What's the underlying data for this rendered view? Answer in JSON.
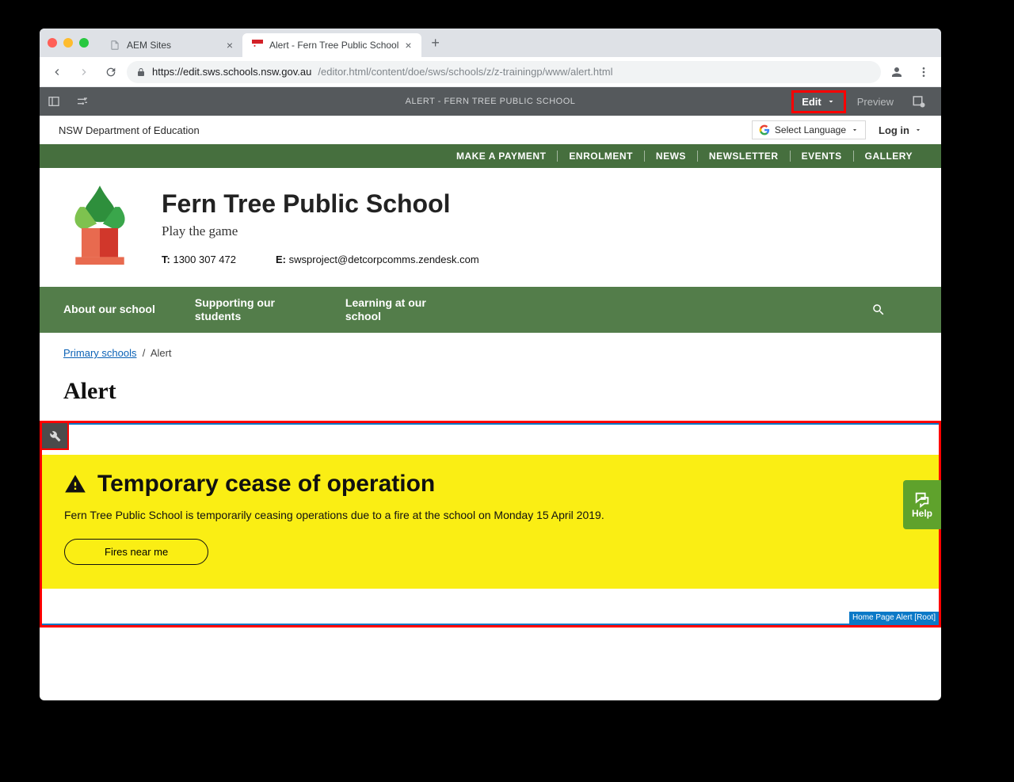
{
  "browser": {
    "tabs": [
      {
        "title": "AEM Sites",
        "active": false
      },
      {
        "title": "Alert - Fern Tree Public School",
        "active": true
      }
    ],
    "url_host": "https://edit.sws.schools.nsw.gov.au",
    "url_path": "/editor.html/content/doe/sws/schools/z/z-trainingp/www/alert.html"
  },
  "editor": {
    "title": "ALERT - FERN TREE PUBLIC SCHOOL",
    "edit_label": "Edit",
    "preview_label": "Preview"
  },
  "topstrip": {
    "dept": "NSW Department of Education",
    "lang_label": "Select Language",
    "login_label": "Log in"
  },
  "greenlinks": [
    "MAKE A PAYMENT",
    "ENROLMENT",
    "NEWS",
    "NEWSLETTER",
    "EVENTS",
    "GALLERY"
  ],
  "school": {
    "name": "Fern Tree Public School",
    "tagline": "Play the game",
    "phone_label": "T:",
    "phone": "1300 307 472",
    "email_label": "E:",
    "email": "swsproject@detcorpcomms.zendesk.com"
  },
  "mainnav": [
    "About our school",
    "Supporting our students",
    "Learning at our school"
  ],
  "breadcrumb": {
    "root": "Primary schools",
    "current": "Alert"
  },
  "page_title": "Alert",
  "alert": {
    "heading": "Temporary cease of operation",
    "body": "Fern Tree Public School is temporarily ceasing operations due to a fire at the school on Monday 15 April 2019.",
    "button": "Fires near me",
    "root_label": "Home Page Alert [Root]"
  },
  "help_label": "Help"
}
